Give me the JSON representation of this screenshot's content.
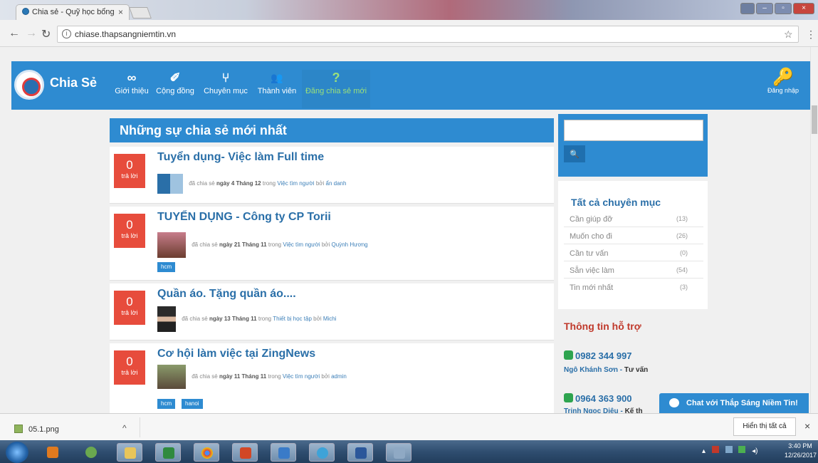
{
  "browser": {
    "tab_title": "Chia sẻ - Quỹ học bổng",
    "tab_close": "×",
    "url": "chiase.thapsangniemtin.vn",
    "url_info": "ⓘ",
    "star": "☆",
    "menu": "⋮"
  },
  "site": {
    "brand": "Chia Sẻ",
    "nav": [
      {
        "label": "Giới thiệu",
        "icon": "∞"
      },
      {
        "label": "Cộng đồng",
        "icon": "✐"
      },
      {
        "label": "Chuyên mục",
        "icon": "⑂"
      },
      {
        "label": "Thành viên",
        "icon": "👥"
      },
      {
        "label": "Đăng chia sẻ mới",
        "icon": "?"
      }
    ],
    "login_label": "Đăng nhập",
    "login_icon": "🔑",
    "list_heading": "Những sự chia sẻ mới nhất",
    "reply_label": "trả lời",
    "posts": [
      {
        "count": "0",
        "title": "Tuyển dụng- Việc làm Full time",
        "shared": "đã chia sẻ",
        "date": "ngày 4 Tháng 12",
        "in": "trong",
        "category": "Việc tìm người",
        "by": "bởi",
        "author": "ẩn danh",
        "tags": []
      },
      {
        "count": "0",
        "title": "TUYỂN DỤNG - Công ty CP Torii",
        "shared": "đã chia sẻ",
        "date": "ngày 21 Tháng 11",
        "in": "trong",
        "category": "Việc tìm người",
        "by": "bởi",
        "author": "Quỳnh Hương",
        "tags": [
          "hcm"
        ]
      },
      {
        "count": "0",
        "title": "Quần áo. Tặng quần áo....",
        "shared": "đã chia sẻ",
        "date": "ngày 13 Tháng 11",
        "in": "trong",
        "category": "Thiết bị học tập",
        "by": "bởi",
        "author": "Michi",
        "tags": []
      },
      {
        "count": "0",
        "title": "Cơ hội làm việc tại ZingNews",
        "shared": "đã chia sẻ",
        "date": "ngày 11 Tháng 11",
        "in": "trong",
        "category": "Việc tìm người",
        "by": "bởi",
        "author": "admin",
        "tags": [
          "hcm",
          "hanoi"
        ]
      }
    ],
    "search_placeholder": "",
    "search_icon": "🔍",
    "categories_heading": "Tất cả chuyên mục",
    "categories": [
      {
        "label": "Cần giúp đỡ",
        "count": "(13)"
      },
      {
        "label": "Muốn cho đi",
        "count": "(26)"
      },
      {
        "label": "Cần tư vấn",
        "count": "(0)"
      },
      {
        "label": "Sẵn việc làm",
        "count": "(54)"
      },
      {
        "label": "Tin mới nhất",
        "count": "(3)"
      }
    ],
    "support_heading": "Thông tin hỗ trợ",
    "support": [
      {
        "phone": "0982 344 997",
        "name": "Ngô Khánh Sơn",
        "role": "Tư vấn"
      },
      {
        "phone": "0964 363 900",
        "name": "Trịnh Ngọc Diệu",
        "role": "Kế th"
      }
    ],
    "chat_label": "Chat với Thắp Sáng Niềm Tin!"
  },
  "downloads": {
    "file": "05.1.png",
    "chevron": "^",
    "show_all": "Hiển thị tất cả",
    "close": "×"
  },
  "taskbar": {
    "time": "3:40 PM",
    "date": "12/26/2017"
  },
  "colors": {
    "header_blue": "#2e8bd1",
    "reply_red": "#e74c3c",
    "support_red": "#c0392b",
    "link_blue": "#2a6fa8"
  }
}
